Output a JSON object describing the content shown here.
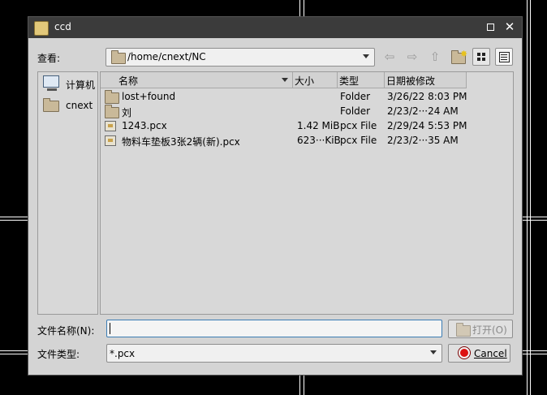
{
  "window": {
    "title": "ccd"
  },
  "toolbar": {
    "look_in_label": "查看:",
    "path": "/home/cnext/NC",
    "back_icon": "back-arrow-icon",
    "forward_icon": "forward-arrow-icon",
    "up_icon": "up-arrow-icon",
    "new_folder_icon": "new-folder-icon",
    "list_view_icon": "list-view-icon",
    "detail_view_icon": "detail-view-icon"
  },
  "sidebar": {
    "items": [
      {
        "label": "计算机",
        "icon": "computer-icon"
      },
      {
        "label": "cnext",
        "icon": "folder-icon"
      }
    ]
  },
  "file_list": {
    "columns": [
      "名称",
      "大小",
      "类型",
      "日期被修改"
    ],
    "rows": [
      {
        "name": "lost+found",
        "size": "",
        "type": "Folder",
        "date": "3/26/22 8:03 PM",
        "icon": "folder-icon"
      },
      {
        "name": "刘",
        "size": "",
        "type": "Folder",
        "date": "2/23/2···24 AM",
        "icon": "folder-icon"
      },
      {
        "name": "1243.pcx",
        "size": "1.42 MiB",
        "type": "pcx File",
        "date": "2/29/24 5:53 PM",
        "icon": "image-file-icon"
      },
      {
        "name": "物料车垫板3张2辆(新).pcx",
        "size": "623···KiB",
        "type": "pcx File",
        "date": "2/23/2···35 AM",
        "icon": "image-file-icon"
      }
    ]
  },
  "bottom": {
    "filename_label": "文件名称(N):",
    "filename_value": "",
    "filetype_label": "文件类型:",
    "filetype_value": "*.pcx",
    "open_label": "打开(O)",
    "cancel_label": "Cancel"
  },
  "colors": {
    "titlebar": "#3b3b3b",
    "dialog_bg": "#d4d4d4",
    "focus_border": "#3b7cb4",
    "cancel_red": "#dd1111"
  }
}
